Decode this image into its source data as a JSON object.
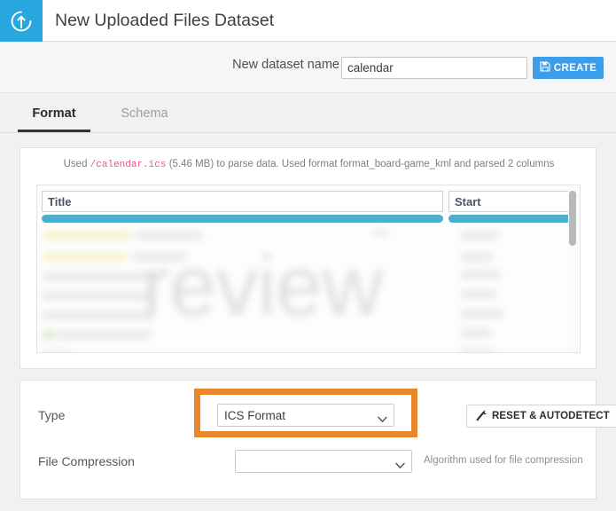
{
  "header": {
    "title": "New Uploaded Files Dataset",
    "logo_icon": "upload-circle-icon",
    "accent_color": "#27a7dd"
  },
  "dataset_name_row": {
    "label": "New dataset name",
    "value": "calendar",
    "placeholder": "",
    "create_label": "CREATE",
    "create_icon": "floppy-disk-icon",
    "create_color": "#3c9de8"
  },
  "tabs": [
    {
      "label": "Format",
      "active": true
    },
    {
      "label": "Schema",
      "active": false
    }
  ],
  "preview": {
    "note_prefix": "Used ",
    "note_file": "/calendar.ics",
    "note_suffix": " (5.46 MB) to parse data. Used format format_board-game_kml and parsed 2 columns",
    "columns": [
      {
        "name": "Title",
        "bar_color": "#4aaecd"
      },
      {
        "name": "Start",
        "bar_color": "#4aaecd"
      }
    ],
    "watermark": "review",
    "scrollbar": "vertical-scrollbar"
  },
  "settings": {
    "type": {
      "label": "Type",
      "value": "ICS Format",
      "highlight_color": "#e8862b",
      "options": [
        "ICS Format"
      ]
    },
    "reset_button": {
      "label": "RESET & AUTODETECT",
      "icon": "magic-wand-icon"
    },
    "compression": {
      "label": "File Compression",
      "value": "",
      "helper": "Algorithm used for file compression",
      "options": [
        ""
      ]
    }
  }
}
